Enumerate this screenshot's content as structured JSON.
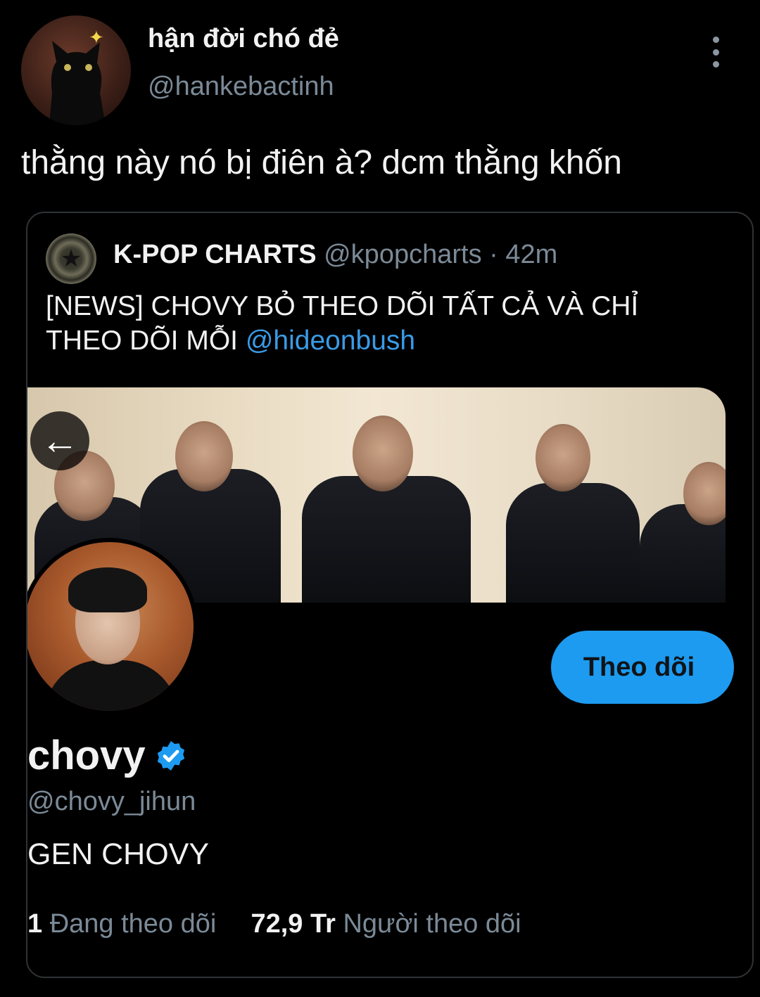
{
  "author": {
    "display_name": "hận đời chó đẻ",
    "handle": "@hankebactinh"
  },
  "tweet": {
    "text": "thằng này nó bị điên à? dcm thằng khốn"
  },
  "quoted": {
    "name": "K-POP CHARTS",
    "handle": "@kpopcharts",
    "separator": " · ",
    "time": "42m",
    "text": "[NEWS] CHOVY BỎ THEO DÕI TẤT CẢ VÀ CHỈ THEO DÕI MỖI ",
    "mention": "@hideonbush",
    "back_icon": "←",
    "profile": {
      "name": "chovy",
      "handle": "@chovy_jihun",
      "bio": "GEN CHOVY",
      "follow_label": "Theo dõi",
      "following_count": "1",
      "following_label": "Đang theo dõi",
      "followers_count": "72,9 Tr",
      "followers_label": "Người theo dõi"
    }
  },
  "colors": {
    "accent": "#1d9bf0",
    "mention": "#3a9be6",
    "muted": "#7b8a97",
    "background": "#000000"
  }
}
